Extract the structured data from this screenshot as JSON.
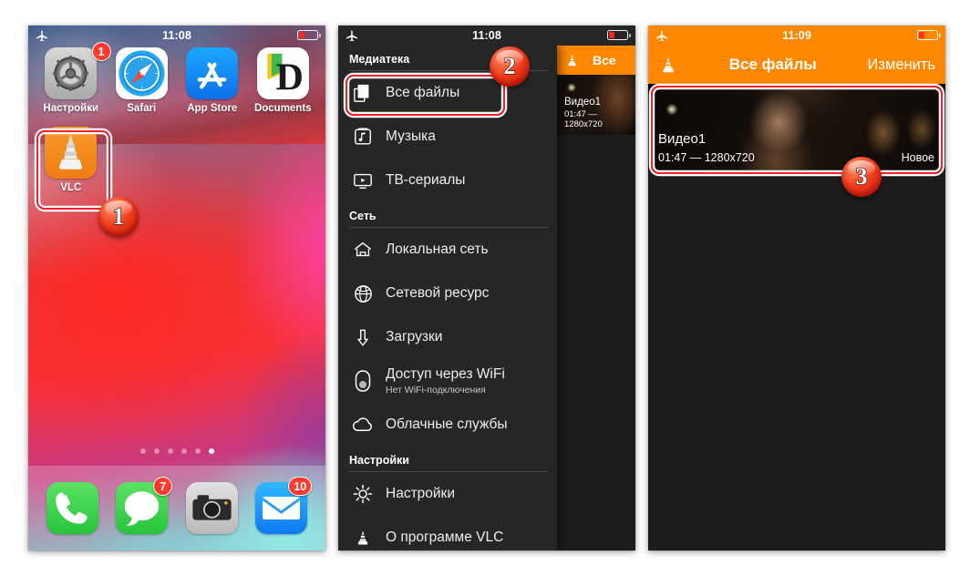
{
  "panel1": {
    "name": "ios-springboard",
    "status": {
      "airplane_icon": "airplane-icon",
      "time": "11:08",
      "battery_icon": "battery-low-icon"
    },
    "apps": [
      {
        "label": "Настройки",
        "icon": "settings-gear-icon",
        "badge": "1"
      },
      {
        "label": "Safari",
        "icon": "safari-compass-icon",
        "badge": ""
      },
      {
        "label": "App Store",
        "icon": "app-store-icon",
        "badge": ""
      },
      {
        "label": "Documents",
        "icon": "documents-icon",
        "badge": ""
      },
      {
        "label": "VLC",
        "icon": "vlc-cone-icon",
        "badge": ""
      }
    ],
    "page_dots": {
      "count": 6,
      "active_index": 5
    },
    "dock": [
      {
        "label": "Phone",
        "icon": "phone-handset-icon",
        "badge": ""
      },
      {
        "label": "Messages",
        "icon": "messages-bubble-icon",
        "badge": "7"
      },
      {
        "label": "Camera",
        "icon": "camera-icon",
        "badge": ""
      },
      {
        "label": "Mail",
        "icon": "mail-envelope-icon",
        "badge": "10"
      }
    ]
  },
  "panel2": {
    "name": "vlc-side-menu",
    "status": {
      "airplane_icon": "airplane-icon",
      "time": "11:08",
      "battery_icon": "battery-low-icon"
    },
    "sections": [
      {
        "header": "Медиатека",
        "items": [
          {
            "label": "Все файлы",
            "sub": "",
            "icon": "files-stack-icon"
          },
          {
            "label": "Музыка",
            "sub": "",
            "icon": "music-note-icon"
          },
          {
            "label": "ТВ-сериалы",
            "sub": "",
            "icon": "tv-icon"
          }
        ]
      },
      {
        "header": "Сеть",
        "items": [
          {
            "label": "Локальная сеть",
            "sub": "",
            "icon": "home-network-icon"
          },
          {
            "label": "Сетевой ресурс",
            "sub": "",
            "icon": "globe-icon"
          },
          {
            "label": "Загрузки",
            "sub": "",
            "icon": "download-arrow-icon"
          },
          {
            "label": "Доступ через WiFi",
            "sub": "Нет WiFi-подключения",
            "icon": "wifi-toggle-icon"
          },
          {
            "label": "Облачные службы",
            "sub": "",
            "icon": "cloud-icon"
          }
        ]
      },
      {
        "header": "Настройки",
        "items": [
          {
            "label": "Настройки",
            "sub": "",
            "icon": "gear-icon"
          },
          {
            "label": "О программе VLC",
            "sub": "",
            "icon": "vlc-cone-icon"
          }
        ]
      }
    ],
    "behind": {
      "nav_title": "Все",
      "vlc_icon": "vlc-cone-icon",
      "cell_title": "Видео1",
      "cell_sub": "01:47 — 1280x720"
    }
  },
  "panel3": {
    "name": "vlc-all-files",
    "status": {
      "airplane_icon": "airplane-icon",
      "time": "11:09",
      "battery_icon": "battery-low-icon"
    },
    "nav": {
      "vlc_icon": "vlc-cone-icon",
      "title": "Все файлы",
      "edit_label": "Изменить"
    },
    "items": [
      {
        "title": "Видео1",
        "sub": "01:47 — 1280x720",
        "state": "Новое"
      }
    ]
  },
  "annotations": {
    "steps": [
      {
        "number": "1",
        "target": "vlc-app-icon"
      },
      {
        "number": "2",
        "target": "all-files-menu-item"
      },
      {
        "number": "3",
        "target": "video1-media-cell"
      }
    ]
  },
  "colors": {
    "vlc_orange": "#ff8800",
    "highlight_red": "#f5222d",
    "badge_red": "#ff3b30",
    "menu_bg": "#262626",
    "app_bg": "#1c1c1c"
  }
}
